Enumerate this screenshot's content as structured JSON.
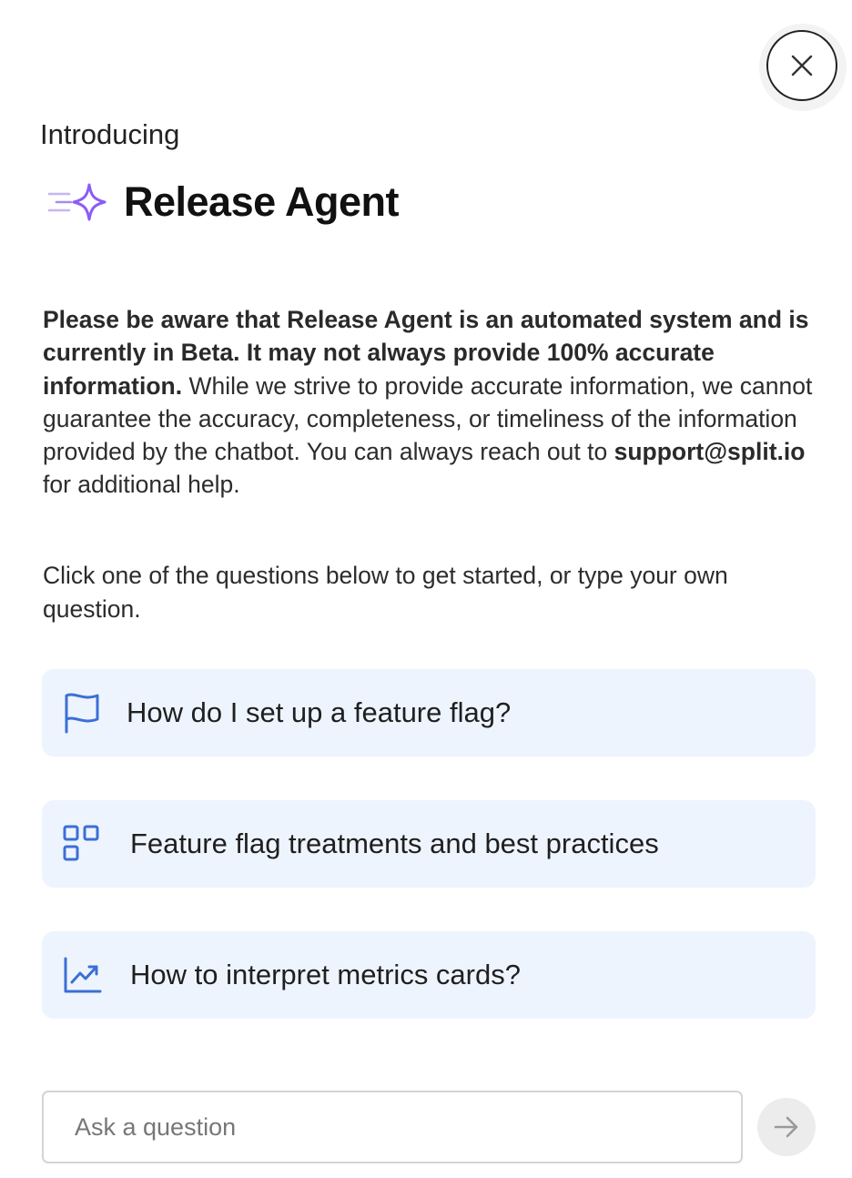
{
  "header": {
    "intro": "Introducing",
    "title": "Release Agent"
  },
  "disclaimer": {
    "bold_text": "Please be aware that Release Agent is an automated system and is currently in Beta. It may not always provide 100% accurate information.",
    "text_1": " While we strive to provide accurate information, we cannot guarantee the accuracy, completeness, or timeliness of the information provided by the chatbot. You can always reach out to ",
    "email": "support@split.io",
    "text_2": " for additional help."
  },
  "prompt": "Click one of the questions below to get started, or type your own question.",
  "suggestions": [
    {
      "label": "How do I set up a feature flag?",
      "icon": "flag-icon"
    },
    {
      "label": "Feature flag treatments and best practices",
      "icon": "grid-icon"
    },
    {
      "label": "How to interpret metrics cards?",
      "icon": "chart-line-icon"
    }
  ],
  "input": {
    "placeholder": "Ask a question",
    "value": ""
  },
  "icons": {
    "close": "close-icon",
    "logo": "sparkle-icon",
    "send": "arrow-right-icon"
  },
  "colors": {
    "accent_purple": "#8b5cf6",
    "icon_blue": "#3b6fd6",
    "suggestion_bg": "#eef4fd"
  }
}
